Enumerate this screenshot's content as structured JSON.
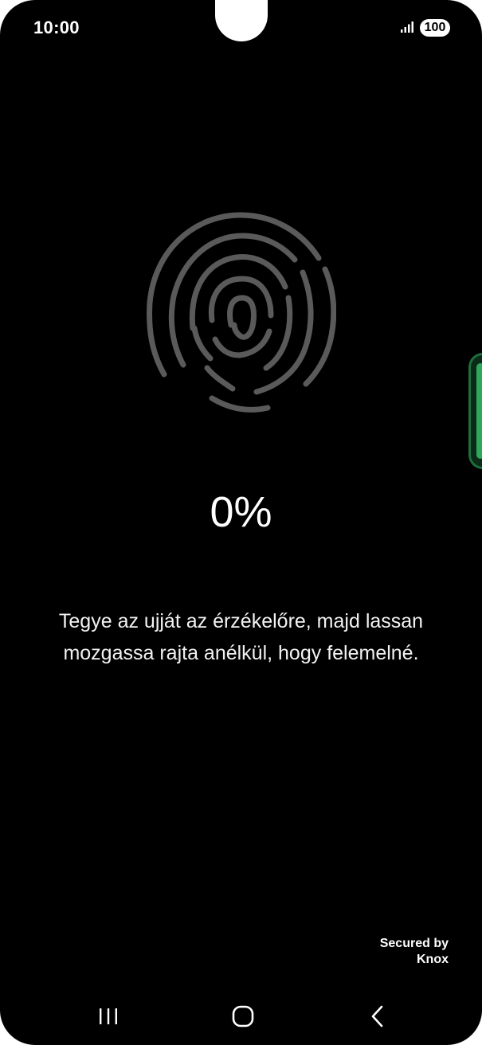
{
  "status_bar": {
    "time": "10:00",
    "battery": "100",
    "signal_icon": "signal-bars-icon"
  },
  "enrollment": {
    "fingerprint_icon": "fingerprint-icon",
    "progress_text": "0%",
    "progress": 0,
    "instruction": "Tegye az ujját az érzékelőre, majd lassan mozgassa rajta anélkül, hogy felemelné."
  },
  "footer": {
    "secured_by": "Secured by",
    "brand": "Knox"
  },
  "nav": {
    "recents_icon": "recents-icon",
    "home_icon": "home-icon",
    "back_icon": "back-icon"
  },
  "colors": {
    "background": "#000000",
    "text": "#ffffff",
    "fingerprint": "#5a5a5a",
    "edge_handle": "#2ea85a"
  }
}
